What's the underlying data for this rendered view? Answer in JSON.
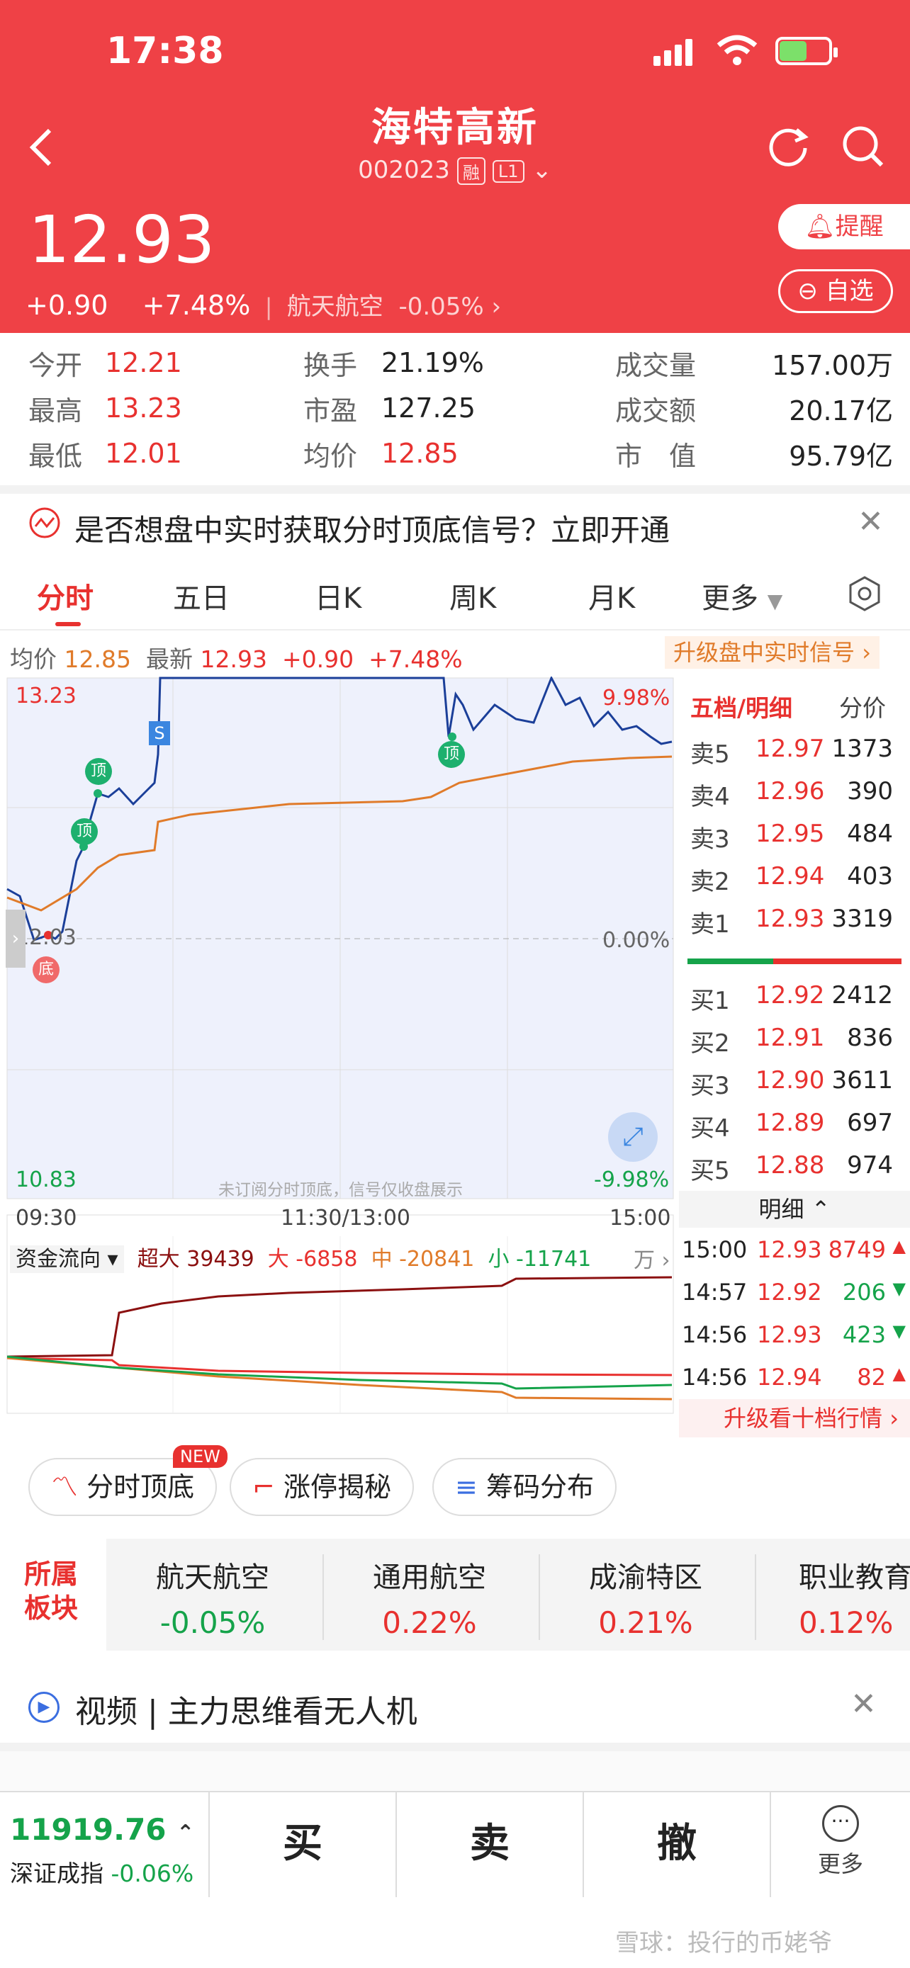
{
  "status": {
    "time": "17:38"
  },
  "header": {
    "name": "海特高新",
    "code": "002023",
    "tag1": "融",
    "tag2": "L1",
    "price": "12.93",
    "change": "+0.90",
    "change_pct": "+7.48%",
    "sector": "航天航空",
    "sector_pct": "-0.05%",
    "remind": "提醒",
    "watch": "自选"
  },
  "quote": {
    "open_l": "今开",
    "open": "12.21",
    "high_l": "最高",
    "high": "13.23",
    "low_l": "最低",
    "low": "12.01",
    "turn_l": "换手",
    "turn": "21.19%",
    "pe_l": "市盈",
    "pe": "127.25",
    "avg_l": "均价",
    "avg": "12.85",
    "vol_l": "成交量",
    "vol": "157.00万",
    "amt_l": "成交额",
    "amt": "20.17亿",
    "mv_l": "市　值",
    "mv": "95.79亿"
  },
  "notice": "是否想盘中实时获取分时顶底信号？立即开通",
  "tabs": [
    "分时",
    "五日",
    "日K",
    "周K",
    "月K",
    "更多"
  ],
  "infobar": {
    "avg_l": "均价",
    "avg": "12.85",
    "last_l": "最新",
    "last": "12.93",
    "chg": "+0.90",
    "pct": "+7.48%",
    "upgrade": "升级盘中实时信号"
  },
  "chart": {
    "ymax": "13.23",
    "ymin": "10.83",
    "mid": "12.03",
    "pmax": "9.98%",
    "pmid": "0.00%",
    "pmin": "-9.98%",
    "t1": "09:30",
    "t2": "11:30/13:00",
    "t3": "15:00",
    "note": "未订阅分时顶底，信号仅收盘展示",
    "marks": [
      "顶",
      "顶",
      "底",
      "S",
      "顶"
    ]
  },
  "flow": {
    "label": "资金流向",
    "xl": "超大",
    "xl_v": "39439",
    "l": "大",
    "l_v": "-6858",
    "m": "中",
    "m_v": "-20841",
    "s": "小",
    "s_v": "-11741",
    "unit": "万"
  },
  "book": {
    "title": "五档/明细",
    "sub": "分价",
    "asks": [
      {
        "n": "卖5",
        "p": "12.97",
        "v": "1373"
      },
      {
        "n": "卖4",
        "p": "12.96",
        "v": "390"
      },
      {
        "n": "卖3",
        "p": "12.95",
        "v": "484"
      },
      {
        "n": "卖2",
        "p": "12.94",
        "v": "403"
      },
      {
        "n": "卖1",
        "p": "12.93",
        "v": "3319"
      }
    ],
    "bids": [
      {
        "n": "买1",
        "p": "12.92",
        "v": "2412"
      },
      {
        "n": "买2",
        "p": "12.91",
        "v": "836"
      },
      {
        "n": "买3",
        "p": "12.90",
        "v": "3611"
      },
      {
        "n": "买4",
        "p": "12.89",
        "v": "697"
      },
      {
        "n": "买5",
        "p": "12.88",
        "v": "974"
      }
    ],
    "detail": "明细",
    "ticks": [
      {
        "t": "15:00",
        "p": "12.93",
        "v": "8749"
      },
      {
        "t": "14:57",
        "p": "12.92",
        "v": "206"
      },
      {
        "t": "14:56",
        "p": "12.93",
        "v": "423"
      },
      {
        "t": "14:56",
        "p": "12.94",
        "v": "82"
      }
    ],
    "upgrade": "升级看十档行情"
  },
  "tools": [
    "分时顶底",
    "涨停揭秘",
    "筹码分布"
  ],
  "new": "NEW",
  "sector_l": "所属\n板块",
  "sectors": [
    {
      "n": "航天航空",
      "v": "-0.05%"
    },
    {
      "n": "通用航空",
      "v": "0.22%"
    },
    {
      "n": "成渝特区",
      "v": "0.21%"
    },
    {
      "n": "职业教育",
      "v": "0.12%"
    }
  ],
  "video": "视频 | 主力思维看无人机",
  "bottom": {
    "index": "11919.76",
    "index_name": "深证成指",
    "index_pct": "-0.06%",
    "buy": "买",
    "sell": "卖",
    "cancel": "撤",
    "more": "更多"
  },
  "watermark": "雪球：投行的币姥爷"
}
